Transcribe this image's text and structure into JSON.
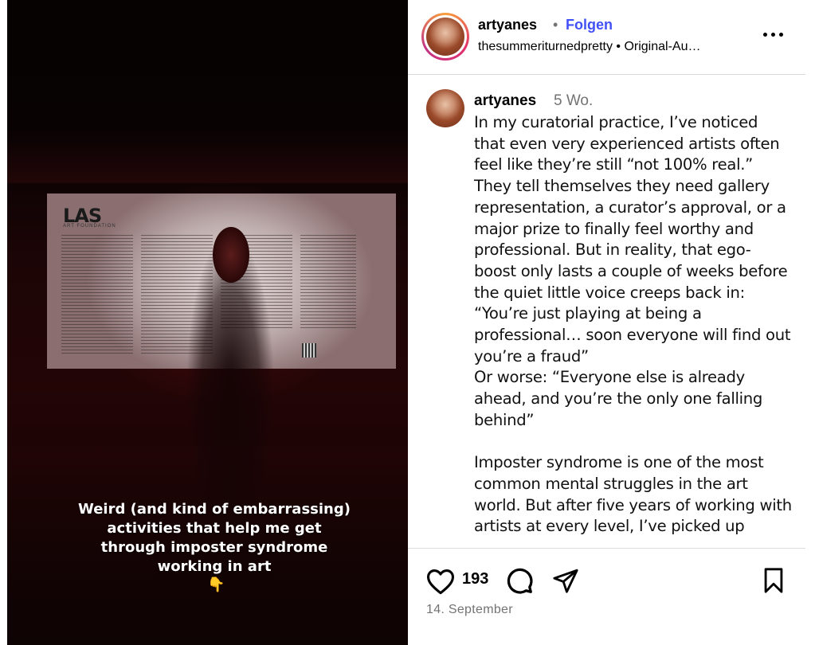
{
  "media": {
    "caption_lines": [
      "Weird (and kind of embarrassing)",
      "activities that help me get",
      "through imposter syndrome",
      "working in art"
    ],
    "caption_emoji": "👇",
    "board_logo": "LAS",
    "board_sub": "ART FOUNDATION"
  },
  "header": {
    "username": "artyanes",
    "separator": "•",
    "follow_label": "Folgen",
    "subtitle": "thesummeriturnedpretty • Original-Au…",
    "more_icon": "more-horizontal-icon"
  },
  "comment": {
    "username": "artyanes",
    "time": "5 Wo.",
    "body": "In my curatorial practice, I’ve noticed that even very experienced artists often feel like they’re still “not 100% real.” They tell themselves they need gallery representation, a curator’s approval, or a major prize to finally feel worthy and professional. But in reality, that ego-boost only lasts a couple of weeks before the quiet little voice creeps back in:\n“You’re just playing at being a professional… soon everyone will find out you’re a fraud”\nOr worse: “Everyone else is already ahead, and you’re the only one falling behind”\n\nImposter syndrome is one of the most common mental struggles in the art world. But after five years of working with artists at every level, I’ve picked up"
  },
  "actions": {
    "like_icon": "heart-icon",
    "likes_count": "193",
    "comment_icon": "comment-icon",
    "share_icon": "send-icon",
    "save_icon": "bookmark-icon",
    "date": "14. September"
  }
}
